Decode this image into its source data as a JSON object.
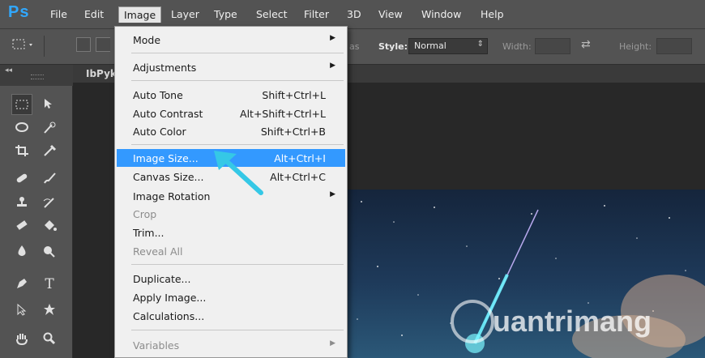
{
  "app": {
    "logo": "Ps",
    "accent": "#31a8ff"
  },
  "menubar": {
    "items": [
      {
        "label": "File"
      },
      {
        "label": "Edit"
      },
      {
        "label": "Image"
      },
      {
        "label": "Layer"
      },
      {
        "label": "Type"
      },
      {
        "label": "Select"
      },
      {
        "label": "Filter"
      },
      {
        "label": "3D"
      },
      {
        "label": "View"
      },
      {
        "label": "Window"
      },
      {
        "label": "Help"
      }
    ],
    "active": "Image"
  },
  "options": {
    "style_label": "Style:",
    "style_value": "Normal",
    "width_label": "Width:",
    "height_label": "Height:",
    "partial_label": "as"
  },
  "document": {
    "tab_label": "IbPyk"
  },
  "image_menu": {
    "items": [
      {
        "label": "Mode",
        "shortcut": "",
        "submenu": true,
        "disabled": false
      },
      {
        "label": "Adjustments",
        "shortcut": "",
        "submenu": true,
        "disabled": false
      },
      {
        "label": "Auto Tone",
        "shortcut": "Shift+Ctrl+L",
        "submenu": false,
        "disabled": false
      },
      {
        "label": "Auto Contrast",
        "shortcut": "Alt+Shift+Ctrl+L",
        "submenu": false,
        "disabled": false
      },
      {
        "label": "Auto Color",
        "shortcut": "Shift+Ctrl+B",
        "submenu": false,
        "disabled": false
      },
      {
        "label": "Image Size...",
        "shortcut": "Alt+Ctrl+I",
        "submenu": false,
        "disabled": false,
        "highlighted": true
      },
      {
        "label": "Canvas Size...",
        "shortcut": "Alt+Ctrl+C",
        "submenu": false,
        "disabled": false
      },
      {
        "label": "Image Rotation",
        "shortcut": "",
        "submenu": true,
        "disabled": false
      },
      {
        "label": "Crop",
        "shortcut": "",
        "submenu": false,
        "disabled": true
      },
      {
        "label": "Trim...",
        "shortcut": "",
        "submenu": false,
        "disabled": false
      },
      {
        "label": "Reveal All",
        "shortcut": "",
        "submenu": false,
        "disabled": true
      },
      {
        "label": "Duplicate...",
        "shortcut": "",
        "submenu": false,
        "disabled": false
      },
      {
        "label": "Apply Image...",
        "shortcut": "",
        "submenu": false,
        "disabled": false
      },
      {
        "label": "Calculations...",
        "shortcut": "",
        "submenu": false,
        "disabled": false
      },
      {
        "label": "Variables",
        "shortcut": "",
        "submenu": true,
        "disabled": true
      }
    ]
  },
  "watermark": {
    "text": "uantrimang"
  },
  "colors": {
    "menu_highlight": "#3399ff",
    "pointer_arrow": "#35c8e6"
  }
}
